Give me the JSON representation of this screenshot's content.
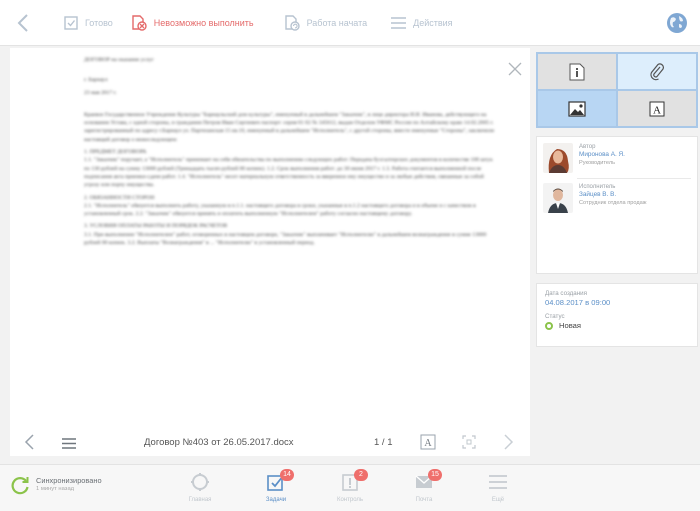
{
  "toolbar": {
    "ready_label": "Готово",
    "impossible_label": "Невозможно выполнить",
    "started_label": "Работа начата",
    "actions_label": "Действия"
  },
  "document": {
    "filename": "Договор №403 от 26.05.2017.docx",
    "pages": "1 / 1",
    "title": "ДОГОВОР на оказание услуг",
    "city": "г. Барнаул",
    "date": "23 мая 2017 г.",
    "intro": "Краевое Государственное Учреждение Культуры \"Барнаульский дом культуры\", именуемый в дальнейшем \"Заказчик\", в лице директора И.И. Иванова, действующего на основании Устава, с одной стороны, и гражданин Петров Иван Сергеевич паспорт: серия 01 02 № 345612, выдан Отделом УФМС России по Алтайскому краю 14.02.2005 г. зарегистрированный по адресу г.Барнаул ул. Партизанская 15 кв.10, именуемый в дальнейшем \"Исполнитель\", с другой стороны, вместе именуемые \"Стороны\", заключили настоящий договор о нижеследующем:",
    "sec1_title": "1. ПРЕДМЕТ ДОГОВОРА",
    "sec1_body": "1.1. \"Заказчик\" поручает, а \"Исполнитель\" принимает на себя обязательства по выполнению следующих работ: Передача бухгалтерских документов в количестве 100 штук по 130 рублей на сумму 13000 рублей (Тринадцать тысяч рублей 00 копеек). 1.2. Срок выполнения работ: до 30 июня 2017 г. 1.3. Работа считается выполненной после подписания акта приемки-сдачи работ. 1.4. \"Исполнитель\" несет материальную ответственность за вверенное ему имущество и за любые действия, связанные за собой угрозу или порчу имущества.",
    "sec2_title": "2. ОБЯЗАННОСТИ СТОРОН",
    "sec2_body": "2.1. \"Исполнитель\" обязуется выполнить работу, указанную в п.1.1. настоящего договора в сроки, указанные в п.1.2 настоящего договора и в объеме и с качеством в установленный срок. 2.2. \"Заказчик\" обязуется принять и оплатить выполненную \"Исполнителем\" работу согласно настоящему договору.",
    "sec3_title": "3. УСЛОВИЯ ОПЛАТЫ РАБОТЫ И ПОРЯДОК РАСЧЕТОВ",
    "sec3_body": "3.1. При выполнении \"Исполнителем\" работ, оговоренных в настоящем договоре, \"Заказчик\" выплачивает \"Исполнителю\" в дальнейшем вознаграждение в сумме 13000 рублей 00 копеек. 3.2. Выплаты \"Вознаграждения\" в ... \"Исполнителю\" в установленный период."
  },
  "people": {
    "author_role": "Автор",
    "author_name": "Миронова А. Я.",
    "author_position": "Руководитель",
    "executor_role": "Исполнитель",
    "executor_name": "Зайцев В. В.",
    "executor_position": "Сотрудник отдела продаж"
  },
  "meta": {
    "created_label": "Дата создания",
    "created_value": "04.08.2017 в 09:00",
    "status_label": "Статус",
    "status_value": "Новая"
  },
  "sync": {
    "title": "Синхронизировано",
    "subtitle": "1 минут назад"
  },
  "nav": {
    "main_label": "Главная",
    "tasks_label": "Задачи",
    "tasks_badge": "14",
    "control_label": "Контроль",
    "control_badge": "2",
    "mail_label": "Почта",
    "mail_badge": "15",
    "more_label": "Ещё"
  },
  "colors": {
    "accent": "#5b8fc7",
    "danger": "#e46a6a",
    "badge": "#ef6f6c",
    "status_new": "#8bc34a",
    "selected_tile": "#b8d6f3"
  },
  "icons": {
    "back": "chevron-left-icon",
    "ready": "checkbox-icon",
    "impossible": "doc-cancel-icon",
    "started": "doc-refresh-icon",
    "actions": "hamburger-icon",
    "globe": "globe-icon",
    "info": "info-icon",
    "attach": "paperclip-icon",
    "image": "image-icon",
    "text": "text-icon"
  }
}
